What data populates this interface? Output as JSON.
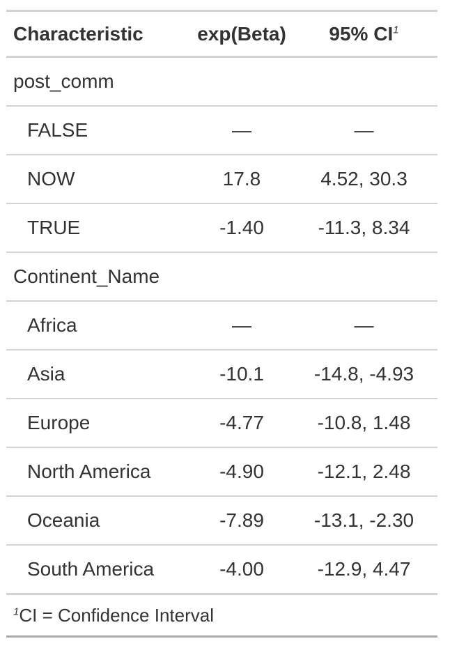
{
  "table": {
    "headers": {
      "characteristic": "Characteristic",
      "estimate": "exp(Beta)",
      "ci": "95% CI",
      "ci_footnote_mark": "1"
    },
    "groups": [
      {
        "label": "post_comm",
        "rows": [
          {
            "label": "FALSE",
            "estimate": "—",
            "ci": "—"
          },
          {
            "label": "NOW",
            "estimate": "17.8",
            "ci": "4.52, 30.3"
          },
          {
            "label": "TRUE",
            "estimate": "-1.40",
            "ci": "-11.3, 8.34"
          }
        ]
      },
      {
        "label": "Continent_Name",
        "rows": [
          {
            "label": "Africa",
            "estimate": "—",
            "ci": "—"
          },
          {
            "label": "Asia",
            "estimate": "-10.1",
            "ci": "-14.8, -4.93"
          },
          {
            "label": "Europe",
            "estimate": "-4.77",
            "ci": "-10.8, 1.48"
          },
          {
            "label": "North America",
            "estimate": "-4.90",
            "ci": "-12.1, 2.48"
          },
          {
            "label": "Oceania",
            "estimate": "-7.89",
            "ci": "-13.1, -2.30"
          },
          {
            "label": "South America",
            "estimate": "-4.00",
            "ci": "-12.9, 4.47"
          }
        ]
      }
    ],
    "footnote": {
      "mark": "1",
      "text": "CI = Confidence Interval"
    }
  }
}
